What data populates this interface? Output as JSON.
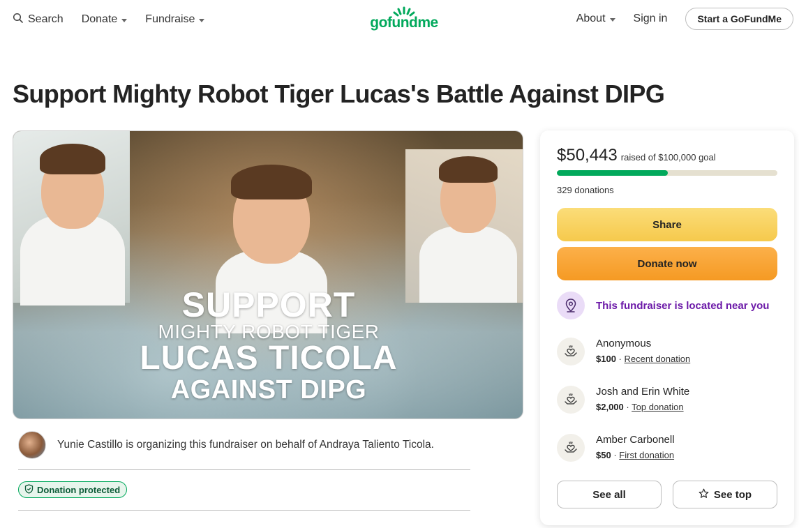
{
  "nav": {
    "search_label": "Search",
    "donate_label": "Donate",
    "fundraise_label": "Fundraise",
    "logo_text": "gofundme",
    "about_label": "About",
    "signin_label": "Sign in",
    "start_label": "Start a GoFundMe"
  },
  "page": {
    "title": "Support Mighty Robot Tiger Lucas's Battle Against DIPG"
  },
  "hero": {
    "line1": "SUPPORT",
    "line2": "MIGHTY ROBOT TIGER",
    "line3": "LUCAS TICOLA",
    "line4": "AGAINST DIPG"
  },
  "organizer": {
    "text": "Yunie Castillo is organizing this fundraiser on behalf of Andraya Taliento Ticola."
  },
  "badge": {
    "label": "Donation protected"
  },
  "card": {
    "raised_amount": "$50,443",
    "raised_goal": "raised of $100,000 goal",
    "progress_fraction": 0.504,
    "donations_count": "329 donations",
    "share_label": "Share",
    "donate_label": "Donate now",
    "near_label": "This fundraiser is located near you",
    "donors": [
      {
        "name": "Anonymous",
        "amount": "$100",
        "sep": "·",
        "tag": "Recent donation"
      },
      {
        "name": "Josh and Erin White",
        "amount": "$2,000",
        "sep": "·",
        "tag": "Top donation"
      },
      {
        "name": "Amber Carbonell",
        "amount": "$50",
        "sep": "·",
        "tag": "First donation"
      }
    ],
    "see_all_label": "See all",
    "see_top_label": "See top"
  },
  "colors": {
    "brand_green": "#02a95c",
    "share_yellow": "#f6c94c",
    "donate_orange": "#f59a23",
    "near_purple": "#6c1aa8"
  }
}
